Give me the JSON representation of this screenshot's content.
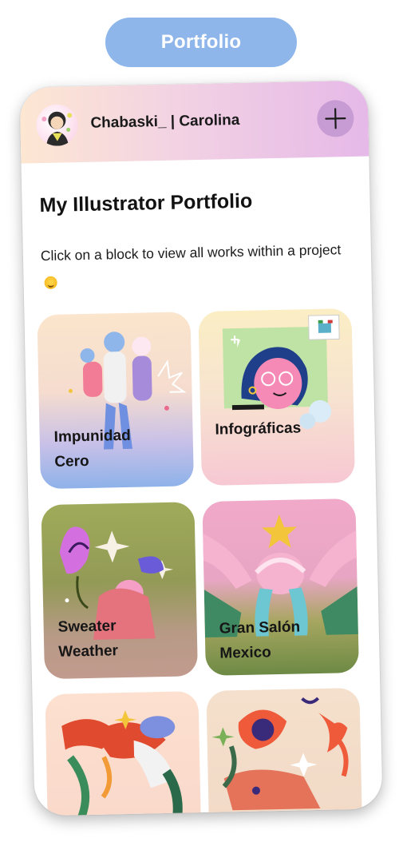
{
  "pill": {
    "label": "Portfolio"
  },
  "header": {
    "handle": "Chabaski_ | Carolina"
  },
  "main": {
    "title": "My Illustrator Portfolio",
    "subtitle": "Click on a block to view all works within a project"
  },
  "tiles": [
    {
      "label": "Impunidad\nCero"
    },
    {
      "label": "Infográficas"
    },
    {
      "label": "Sweater\nWeather"
    },
    {
      "label": "Gran Salón\nMexico"
    },
    {
      "label": ""
    },
    {
      "label": ""
    }
  ]
}
